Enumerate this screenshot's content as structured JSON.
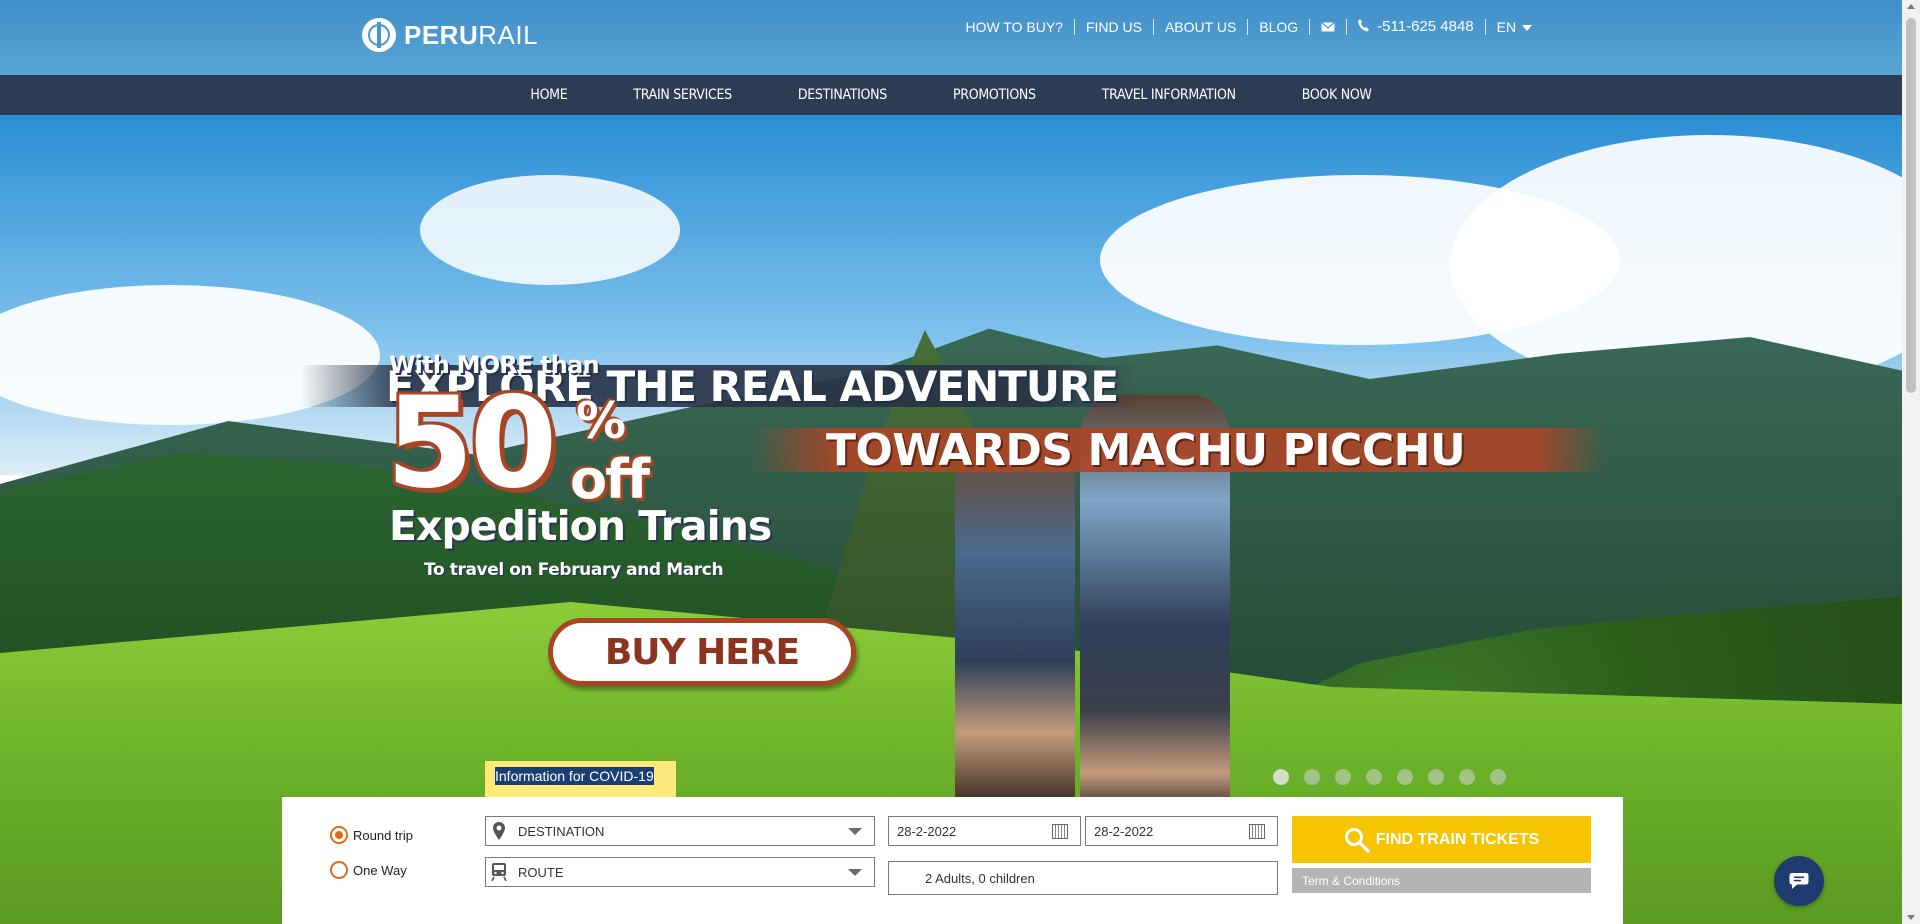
{
  "header": {
    "logo_bold": "PERU",
    "logo_light": "RAIL",
    "links": [
      "HOW TO BUY?",
      "FIND US",
      "ABOUT US",
      "BLOG"
    ],
    "phone": "-511-625 4848",
    "language": "EN",
    "icons": [
      "mail-icon",
      "phone-icon",
      "chevron-down-icon"
    ]
  },
  "nav": {
    "items": [
      "HOME",
      "TRAIN SERVICES",
      "DESTINATIONS",
      "PROMOTIONS",
      "TRAVEL INFORMATION",
      "BOOK NOW"
    ]
  },
  "hero": {
    "headline1": "EXPLORE THE REAL ADVENTURE",
    "headline2": "TOWARDS MACHU PICCHU",
    "with_more": "With MORE than",
    "big_number": "50",
    "percent": "%",
    "off": "off",
    "expedition": "Expedition Trains",
    "travel_note": "To travel on February and March",
    "cta": "BUY HERE",
    "slide_count": 8,
    "active_slide": 1
  },
  "covid": {
    "label": "Information for COVID-19"
  },
  "search": {
    "round_trip": "Round trip",
    "one_way": "One Way",
    "selected_trip": "Round trip",
    "destination": "DESTINATION",
    "route": "ROUTE",
    "date_out": "28-2-2022",
    "date_return": "28-2-2022",
    "passengers": "2 Adults, 0 children",
    "find_button": "FIND TRAIN TICKETS",
    "terms": "Term & Conditions"
  },
  "colors": {
    "topbar": "#4a96cf",
    "nav": "#2e3b55",
    "accent": "#e46a1b",
    "find_button": "#f6c400",
    "promo_red": "#a84525"
  }
}
